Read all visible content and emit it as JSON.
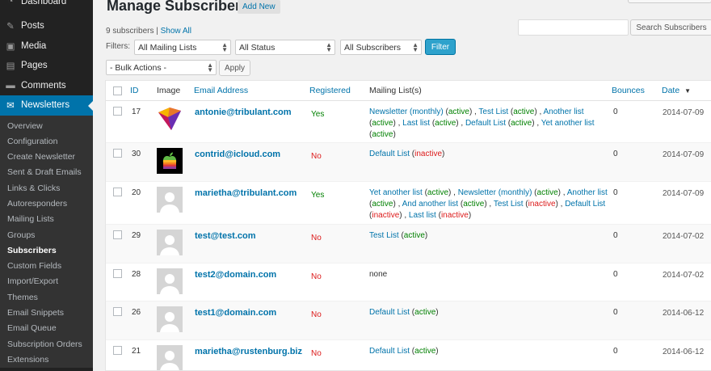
{
  "sidebar": {
    "top_items": [
      {
        "label": "Dashboard",
        "icon": "dashboard-icon"
      },
      {
        "label": "Posts",
        "icon": "pin-icon"
      },
      {
        "label": "Media",
        "icon": "media-icon"
      },
      {
        "label": "Pages",
        "icon": "pages-icon"
      },
      {
        "label": "Comments",
        "icon": "comment-icon"
      },
      {
        "label": "Newsletters",
        "icon": "envelope-icon"
      }
    ],
    "sub_items": [
      "Overview",
      "Configuration",
      "Create Newsletter",
      "Sent & Draft Emails",
      "Links & Clicks",
      "Autoresponders",
      "Mailing Lists",
      "Groups",
      "Subscribers",
      "Custom Fields",
      "Import/Export",
      "Themes",
      "Email Snippets",
      "Email Queue",
      "Subscription Orders",
      "Extensions"
    ],
    "current_sub": "Subscribers"
  },
  "header": {
    "title": "Manage Subscribers",
    "add_new": "Add New"
  },
  "summary": {
    "count_text": "9 subscribers",
    "separator": "|",
    "show_all": "Show All"
  },
  "search": {
    "button": "Search Subscribers",
    "value": ""
  },
  "filters": {
    "label": "Filters:",
    "mailing_list": "All Mailing Lists",
    "status": "All Status",
    "subscribers": "All Subscribers",
    "button": "Filter"
  },
  "bulk": {
    "selected": "- Bulk Actions -",
    "apply": "Apply"
  },
  "table": {
    "columns": {
      "id": "ID",
      "image": "Image",
      "email": "Email Address",
      "registered": "Registered",
      "lists": "Mailing List(s)",
      "bounces": "Bounces",
      "date": "Date"
    },
    "sort_indicator": "▼",
    "rows": [
      {
        "id": "17",
        "avatar": "logo-gem",
        "email": "antonie@tribulant.com",
        "registered": "Yes",
        "bounces": "0",
        "date": "2014-07-09",
        "lists": [
          {
            "name": "Newsletter (monthly)",
            "status": "active"
          },
          {
            "name": "Test List",
            "status": "active"
          },
          {
            "name": "Another list",
            "status": "active"
          },
          {
            "name": "Last list",
            "status": "active"
          },
          {
            "name": "Default List",
            "status": "active"
          },
          {
            "name": "Yet another list",
            "status": "active"
          }
        ]
      },
      {
        "id": "30",
        "avatar": "apple-logo",
        "email": "contrid@icloud.com",
        "registered": "No",
        "bounces": "0",
        "date": "2014-07-09",
        "lists": [
          {
            "name": "Default List",
            "status": "inactive"
          }
        ]
      },
      {
        "id": "20",
        "avatar": "default",
        "email": "marietha@tribulant.com",
        "registered": "Yes",
        "bounces": "0",
        "date": "2014-07-09",
        "lists": [
          {
            "name": "Yet another list",
            "status": "active"
          },
          {
            "name": "Newsletter (monthly)",
            "status": "active"
          },
          {
            "name": "Another list",
            "status": "active"
          },
          {
            "name": "And another list",
            "status": "active"
          },
          {
            "name": "Test List",
            "status": "inactive"
          },
          {
            "name": "Default List",
            "status": "inactive"
          },
          {
            "name": "Last list",
            "status": "inactive"
          }
        ]
      },
      {
        "id": "29",
        "avatar": "default",
        "email": "test@test.com",
        "registered": "No",
        "bounces": "0",
        "date": "2014-07-02",
        "lists": [
          {
            "name": "Test List",
            "status": "active"
          }
        ]
      },
      {
        "id": "28",
        "avatar": "default",
        "email": "test2@domain.com",
        "registered": "No",
        "bounces": "0",
        "date": "2014-07-02",
        "lists": [],
        "lists_text": "none"
      },
      {
        "id": "26",
        "avatar": "default",
        "email": "test1@domain.com",
        "registered": "No",
        "bounces": "0",
        "date": "2014-06-12",
        "lists": [
          {
            "name": "Default List",
            "status": "active"
          }
        ]
      },
      {
        "id": "21",
        "avatar": "default",
        "email": "marietha@rustenburg.biz",
        "registered": "No",
        "bounces": "0",
        "date": "2014-06-12",
        "lists": [
          {
            "name": "Default List",
            "status": "active"
          }
        ]
      }
    ]
  },
  "colors": {
    "accent": "#0073aa",
    "sidebar_bg": "#222222",
    "active_menu": "#0073aa",
    "status_active": "#008000",
    "status_inactive": "#dc1a1a",
    "filter_button": "#2ea2cc"
  }
}
